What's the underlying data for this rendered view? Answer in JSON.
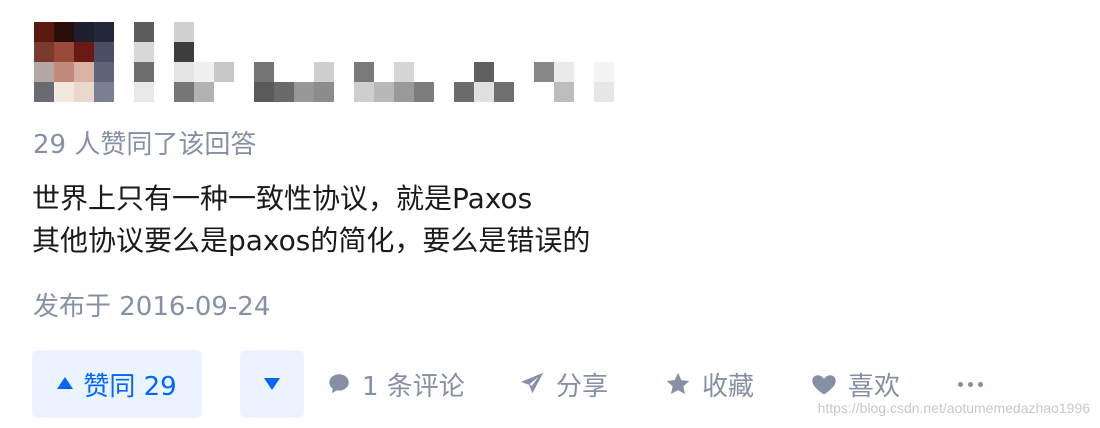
{
  "answer": {
    "vote_summary": "29 人赞同了该回答",
    "content_lines": [
      "世界上只有一种一致性协议，就是Paxos",
      "其他协议要么是paxos的简化，要么是错误的"
    ],
    "published": "发布于 2016-09-24"
  },
  "actions": {
    "upvote_label": "赞同 29",
    "comment_label": "1 条评论",
    "share_label": "分享",
    "favorite_label": "收藏",
    "like_label": "喜欢"
  },
  "icons": {
    "upvote": "triangle-up-icon",
    "downvote": "triangle-down-icon",
    "comment": "speech-bubble-icon",
    "share": "paper-plane-icon",
    "favorite": "star-icon",
    "like": "heart-icon",
    "more": "more-dots-icon"
  },
  "colors": {
    "accent": "#0066ff",
    "button_bg": "#ebf3ff",
    "meta_text": "#8590a6",
    "body_text": "#1a1a1a"
  },
  "watermark": "https://blog.csdn.net/aotumemedazhao1996"
}
